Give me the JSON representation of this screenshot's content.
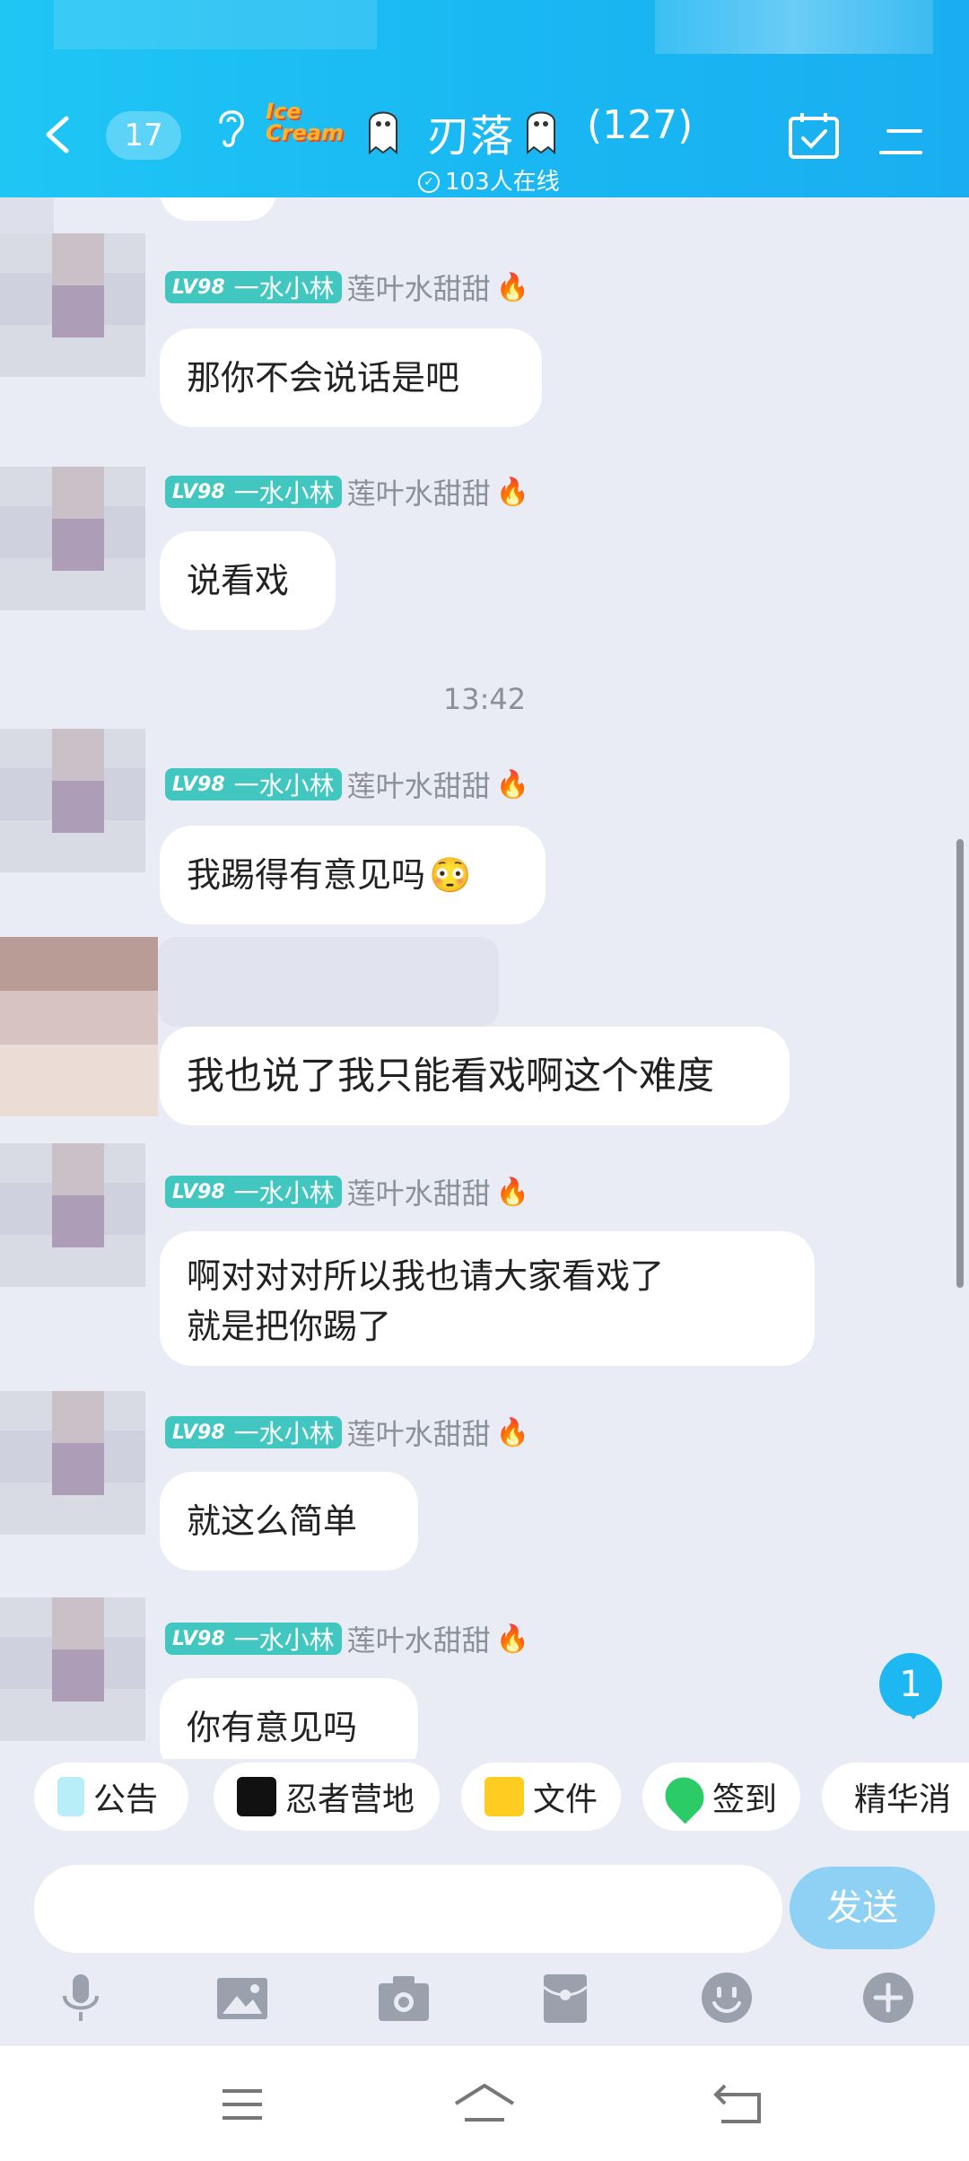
{
  "header": {
    "unread_count": "17",
    "logo_text": "Ice Cream",
    "group_name": "刃落",
    "member_count": "(127)",
    "online_text": "103人在线"
  },
  "messages": [
    {
      "badge_level": "LV98",
      "badge_title": "一水小林",
      "sender": "莲叶水甜甜",
      "text": "那你不会说话是吧"
    },
    {
      "badge_level": "LV98",
      "badge_title": "一水小林",
      "sender": "莲叶水甜甜",
      "text": "说看戏"
    },
    {
      "badge_level": "LV98",
      "badge_title": "一水小林",
      "sender": "莲叶水甜甜",
      "text": "我踢得有意见吗"
    },
    {
      "text": "我也说了我只能看戏啊这个难度"
    },
    {
      "badge_level": "LV98",
      "badge_title": "一水小林",
      "sender": "莲叶水甜甜",
      "line1": "啊对对对所以我也请大家看戏了",
      "line2": "就是把你踢了"
    },
    {
      "badge_level": "LV98",
      "badge_title": "一水小林",
      "sender": "莲叶水甜甜",
      "text": "就这么简单"
    },
    {
      "badge_level": "LV98",
      "badge_title": "一水小林",
      "sender": "莲叶水甜甜",
      "text": "你有意见吗"
    }
  ],
  "timestamp": "13:42",
  "new_message_count": "1",
  "toolbar": {
    "announcement": "公告",
    "ninja_camp": "忍者营地",
    "files": "文件",
    "checkin": "签到",
    "essence": "精华消"
  },
  "input": {
    "placeholder": "",
    "send_label": "发送"
  },
  "icons": [
    "back-icon",
    "ear-icon",
    "ghost-icon",
    "calendar-check-icon",
    "menu-icon",
    "fire-icon",
    "mic-icon",
    "image-icon",
    "camera-icon",
    "red-packet-icon",
    "emoji-icon",
    "plus-icon",
    "nav-menu-icon",
    "nav-home-icon",
    "nav-back-icon"
  ],
  "colors": {
    "header": "#1fc6f4",
    "badge": "#42c7c0",
    "send": "#8fd0f5",
    "accent": "#1db8f2"
  }
}
